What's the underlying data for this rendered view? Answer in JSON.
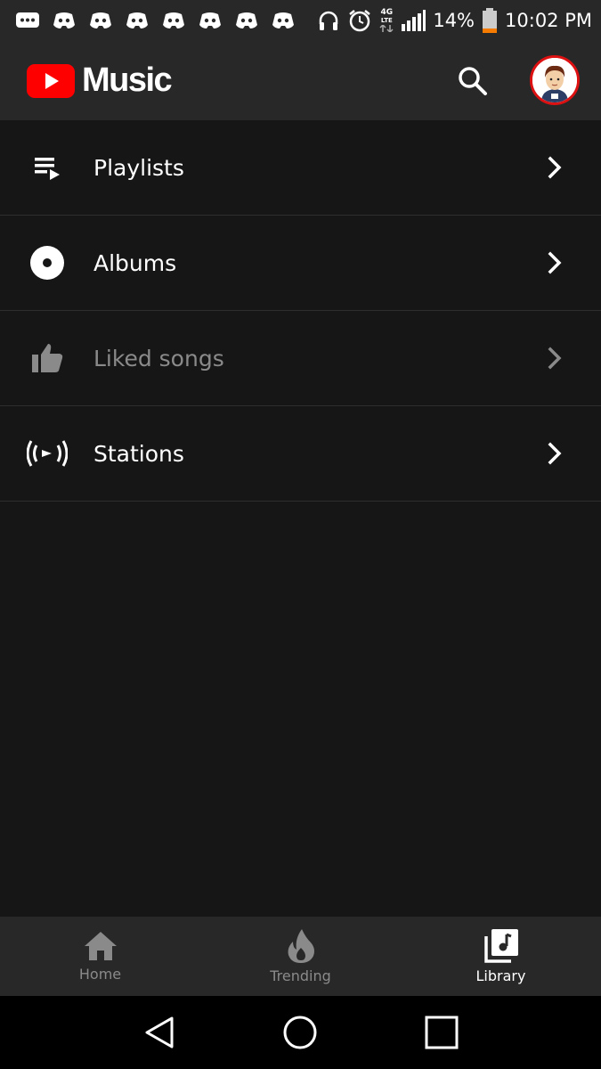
{
  "status_bar": {
    "notification_icons": [
      "message-icon",
      "discord-icon",
      "discord-icon",
      "discord-icon",
      "discord-icon",
      "discord-icon",
      "discord-icon",
      "discord-icon"
    ],
    "network_type": "4G",
    "network_sub": "LTE",
    "battery": "14%",
    "time": "10:02 PM"
  },
  "app_bar": {
    "logo_text": "Music",
    "brand_color": "#FF0000"
  },
  "library": {
    "items": [
      {
        "label": "Playlists",
        "icon": "playlist-icon",
        "enabled": true
      },
      {
        "label": "Albums",
        "icon": "album-icon",
        "enabled": true
      },
      {
        "label": "Liked songs",
        "icon": "thumbs-up-icon",
        "enabled": false
      },
      {
        "label": "Stations",
        "icon": "radio-icon",
        "enabled": true
      }
    ]
  },
  "bottom_nav": {
    "tabs": [
      {
        "label": "Home",
        "icon": "home-icon",
        "active": false
      },
      {
        "label": "Trending",
        "icon": "flame-icon",
        "active": false
      },
      {
        "label": "Library",
        "icon": "library-icon",
        "active": true
      }
    ]
  },
  "system_nav": {
    "buttons": [
      "back-icon",
      "home-circle-icon",
      "recents-icon"
    ]
  }
}
